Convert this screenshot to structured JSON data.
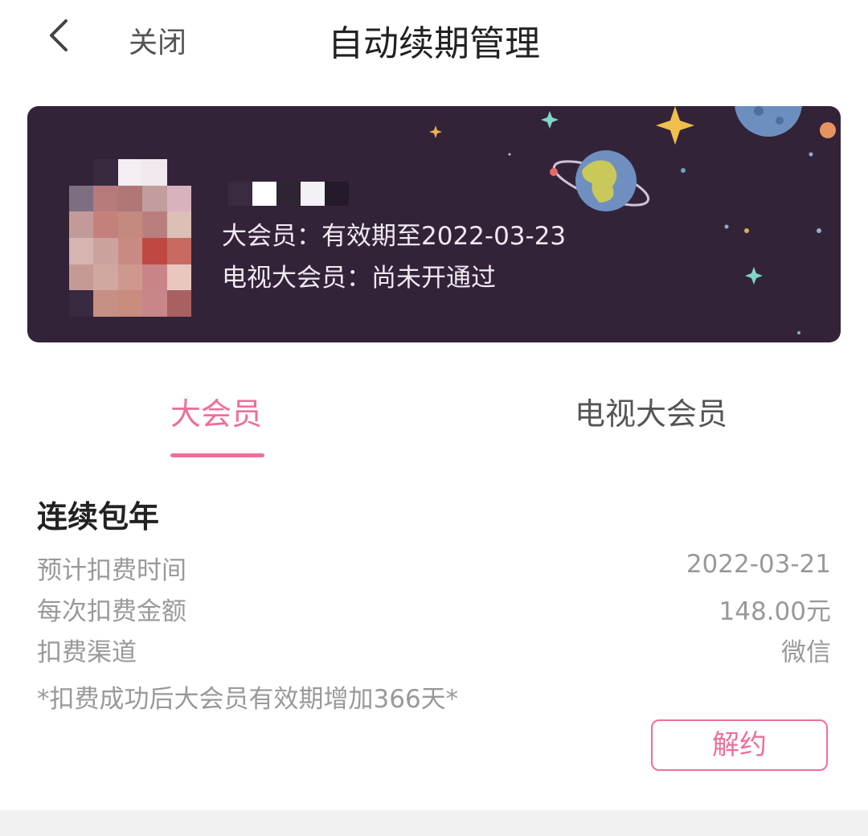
{
  "nav": {
    "close_label": "关闭",
    "title": "自动续期管理"
  },
  "card": {
    "vip_line": "大会员：有效期至2022-03-23",
    "tv_line": "电视大会员：尚未开通过",
    "background_color": "#332339"
  },
  "tabs": [
    {
      "label": "大会员",
      "active": true
    },
    {
      "label": "电视大会员",
      "active": false
    }
  ],
  "plan": {
    "title": "连续包年",
    "rows": [
      {
        "label": "预计扣费时间",
        "value": "2022-03-21"
      },
      {
        "label": "每次扣费金额",
        "value": "148.00元"
      },
      {
        "label": "扣费渠道",
        "value": "微信"
      }
    ],
    "note": "*扣费成功后大会员有效期增加366天*",
    "cancel_label": "解约"
  },
  "colors": {
    "accent": "#ee6f98"
  }
}
